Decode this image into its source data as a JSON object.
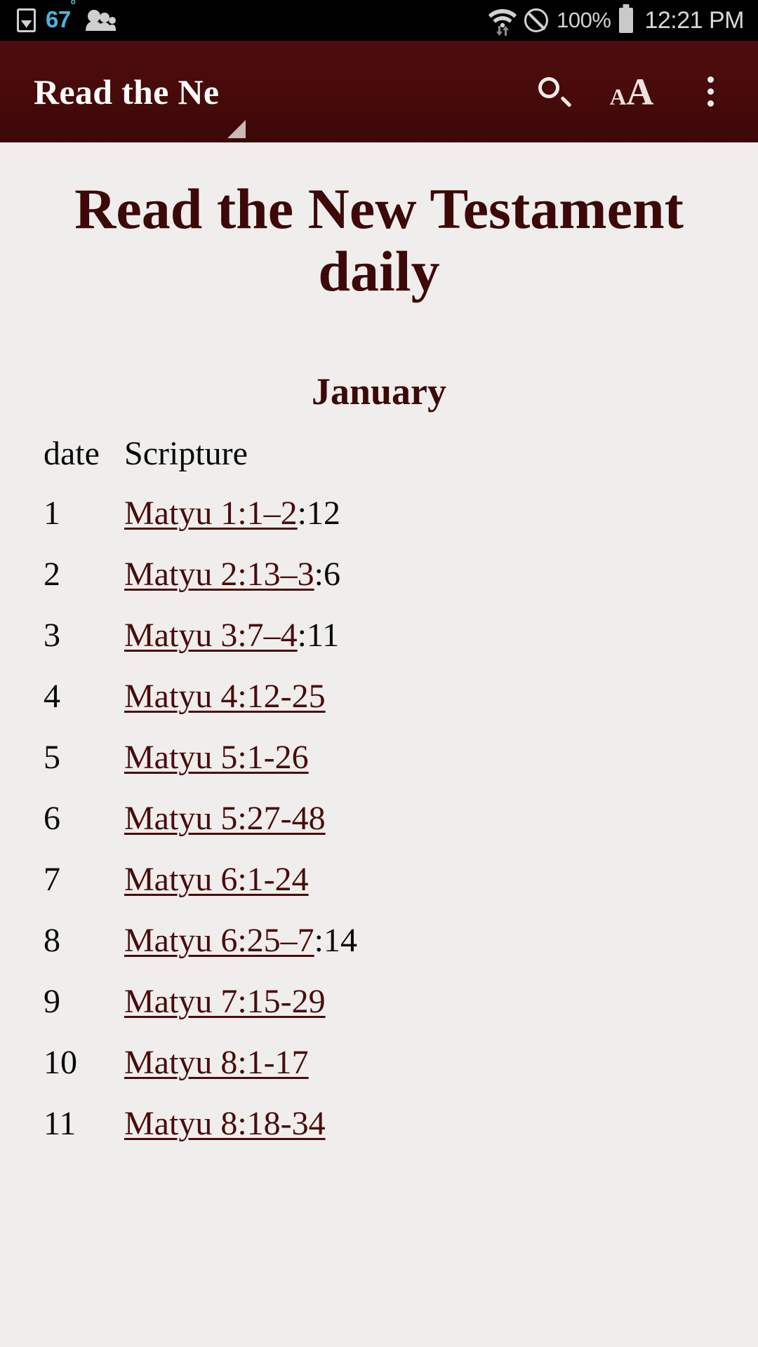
{
  "status_bar": {
    "gallery_icon": "gallery-icon",
    "temperature": "67",
    "temperature_unit": "º",
    "people_icon": "people-icon",
    "wifi_icon": "wifi-icon",
    "dnd_icon": "do-not-disturb-icon",
    "battery_percent": "100%",
    "battery_icon": "battery-icon",
    "time": "12:21 PM"
  },
  "app_bar": {
    "title": "Read the Ne",
    "search_icon": "search-icon",
    "text_size_small": "A",
    "text_size_big": "A",
    "overflow_icon": "more-vertical-icon"
  },
  "content": {
    "doc_title": "Read the New Testament daily",
    "month": "January",
    "columns": {
      "date": "date",
      "scripture": "Scripture"
    },
    "rows": [
      {
        "date": "1",
        "link": "Matyu 1:1–2",
        "tail": ":12"
      },
      {
        "date": "2",
        "link": "Matyu 2:13–3",
        "tail": ":6"
      },
      {
        "date": "3",
        "link": "Matyu 3:7–4",
        "tail": ":11"
      },
      {
        "date": "4",
        "link": "Matyu 4:12-25",
        "tail": ""
      },
      {
        "date": "5",
        "link": "Matyu 5:1-26",
        "tail": ""
      },
      {
        "date": "6",
        "link": "Matyu 5:27-48",
        "tail": ""
      },
      {
        "date": "7",
        "link": "Matyu 6:1-24",
        "tail": ""
      },
      {
        "date": "8",
        "link": "Matyu 6:25–7",
        "tail": ":14"
      },
      {
        "date": "9",
        "link": "Matyu 7:15-29",
        "tail": ""
      },
      {
        "date": "10",
        "link": "Matyu 8:1-17",
        "tail": ""
      },
      {
        "date": "11",
        "link": "Matyu 8:18-34",
        "tail": ""
      }
    ]
  },
  "colors": {
    "app_bar_bg": "#470a0a",
    "accent_maroon": "#4a0c0c",
    "page_bg": "#efeeec",
    "temp_blue": "#4ab5d8"
  }
}
